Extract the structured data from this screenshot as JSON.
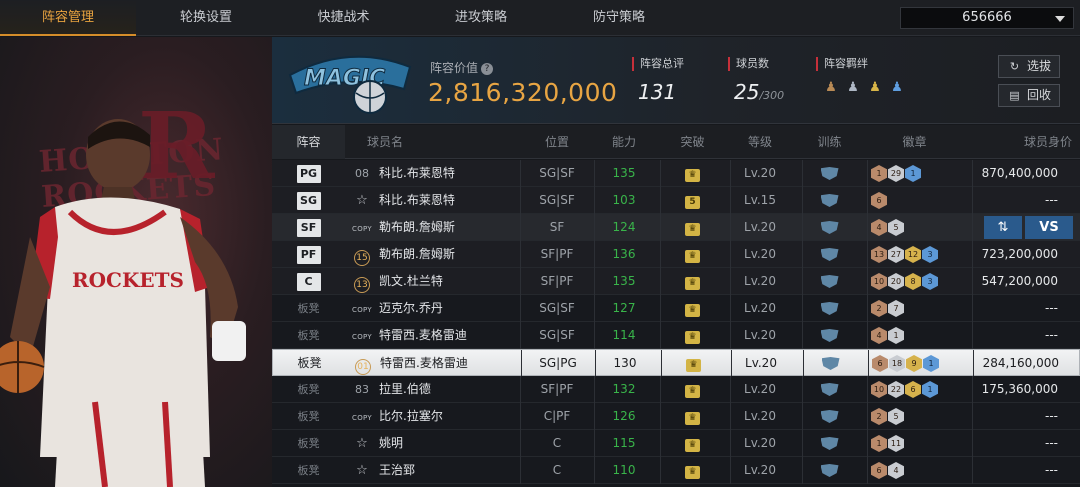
{
  "tabs": [
    {
      "label": "阵容管理",
      "active": true
    },
    {
      "label": "轮换设置",
      "active": false
    },
    {
      "label": "快捷战术",
      "active": false
    },
    {
      "label": "进攻策略",
      "active": false
    },
    {
      "label": "防守策略",
      "active": false
    }
  ],
  "account": {
    "value": "656666"
  },
  "left_panel": {
    "bg_text": "HOUSTON ROCKETS",
    "jersey": "ROCKETS"
  },
  "team_logo": {
    "text": "MAGIC"
  },
  "lineup_value": {
    "label": "阵容价值",
    "value": "2,816,320,000"
  },
  "stats": {
    "rating": {
      "label": "阵容总评",
      "value": "131"
    },
    "players": {
      "label": "球员数",
      "value": "25",
      "max": "/300"
    },
    "bonds": {
      "label": "阵容羁绊"
    }
  },
  "buttons": {
    "select": "选拔",
    "recycle": "回收",
    "swap_icon": "⇅",
    "vs": "VS"
  },
  "columns": {
    "lineup": "阵容",
    "name": "球员名",
    "position": "位置",
    "ability": "能力",
    "breakthrough": "突破",
    "level": "等级",
    "training": "训练",
    "badges": "徽章",
    "price": "球员身价"
  },
  "rows": [
    {
      "slot": "PG",
      "num": "08",
      "icon": "num",
      "name": "科比.布莱恩特",
      "position": "SG|SF",
      "ability": "135",
      "break": "crown",
      "level": "Lv.20",
      "badges": [
        [
          "b",
          "1"
        ],
        [
          "s",
          "29"
        ],
        [
          "bl",
          "1"
        ]
      ],
      "price": "870,400,000",
      "style": "starter"
    },
    {
      "slot": "SG",
      "num": "",
      "icon": "star",
      "name": "科比.布莱恩特",
      "position": "SG|SF",
      "ability": "103",
      "break": "5",
      "level": "Lv.15",
      "badges": [
        [
          "b",
          "6"
        ]
      ],
      "price": "---",
      "style": "starter"
    },
    {
      "slot": "SF",
      "num": "COPY",
      "icon": "copy",
      "name": "勒布朗.詹姆斯",
      "position": "SF",
      "ability": "124",
      "break": "crown",
      "level": "Lv.20",
      "badges": [
        [
          "b",
          "4"
        ],
        [
          "s",
          "5"
        ]
      ],
      "price": "",
      "style": "dim"
    },
    {
      "slot": "PF",
      "num": "15",
      "icon": "circle",
      "name": "勒布朗.詹姆斯",
      "position": "SF|PF",
      "ability": "136",
      "break": "crown",
      "level": "Lv.20",
      "badges": [
        [
          "b",
          "13"
        ],
        [
          "s",
          "27"
        ],
        [
          "g",
          "12"
        ],
        [
          "bl",
          "3"
        ]
      ],
      "price": "723,200,000",
      "style": "starter"
    },
    {
      "slot": "C",
      "num": "13",
      "icon": "circle",
      "name": "凯文.杜兰特",
      "position": "SF|PF",
      "ability": "135",
      "break": "crown",
      "level": "Lv.20",
      "badges": [
        [
          "b",
          "10"
        ],
        [
          "s",
          "20"
        ],
        [
          "g",
          "8"
        ],
        [
          "bl",
          "3"
        ]
      ],
      "price": "547,200,000",
      "style": "starter"
    },
    {
      "slot": "板凳",
      "num": "COPY",
      "icon": "copy",
      "name": "迈克尔.乔丹",
      "position": "SG|SF",
      "ability": "127",
      "break": "crown",
      "level": "Lv.20",
      "badges": [
        [
          "b",
          "2"
        ],
        [
          "s",
          "7"
        ]
      ],
      "price": "---",
      "style": "bench"
    },
    {
      "slot": "板凳",
      "num": "COPY",
      "icon": "copy",
      "name": "特雷西.麦格雷迪",
      "position": "SG|SF",
      "ability": "114",
      "break": "crown",
      "level": "Lv.20",
      "badges": [
        [
          "b",
          "4"
        ],
        [
          "s",
          "1"
        ]
      ],
      "price": "---",
      "style": "bench"
    },
    {
      "slot": "板凳",
      "num": "01",
      "icon": "circle",
      "name": "特雷西.麦格雷迪",
      "position": "SG|PG",
      "ability": "130",
      "break": "crown",
      "level": "Lv.20",
      "badges": [
        [
          "b",
          "6"
        ],
        [
          "s",
          "18"
        ],
        [
          "g",
          "9"
        ],
        [
          "bl",
          "1"
        ]
      ],
      "price": "284,160,000",
      "style": "hl"
    },
    {
      "slot": "板凳",
      "num": "83",
      "icon": "num",
      "name": "拉里.伯德",
      "position": "SF|PF",
      "ability": "132",
      "break": "crown",
      "level": "Lv.20",
      "badges": [
        [
          "b",
          "10"
        ],
        [
          "s",
          "22"
        ],
        [
          "g",
          "6"
        ],
        [
          "bl",
          "1"
        ]
      ],
      "price": "175,360,000",
      "style": "bench"
    },
    {
      "slot": "板凳",
      "num": "COPY",
      "icon": "copy",
      "name": "比尔.拉塞尔",
      "position": "C|PF",
      "ability": "126",
      "break": "crown",
      "level": "Lv.20",
      "badges": [
        [
          "b",
          "2"
        ],
        [
          "s",
          "5"
        ]
      ],
      "price": "---",
      "style": "bench"
    },
    {
      "slot": "板凳",
      "num": "",
      "icon": "star",
      "name": "姚明",
      "position": "C",
      "ability": "115",
      "break": "crown",
      "level": "Lv.20",
      "badges": [
        [
          "b",
          "1"
        ],
        [
          "s",
          "11"
        ]
      ],
      "price": "---",
      "style": "bench"
    },
    {
      "slot": "板凳",
      "num": "",
      "icon": "star",
      "name": "王治郅",
      "position": "C",
      "ability": "110",
      "break": "crown",
      "level": "Lv.20",
      "badges": [
        [
          "b",
          "6"
        ],
        [
          "s",
          "4"
        ]
      ],
      "price": "---",
      "style": "bench"
    }
  ]
}
